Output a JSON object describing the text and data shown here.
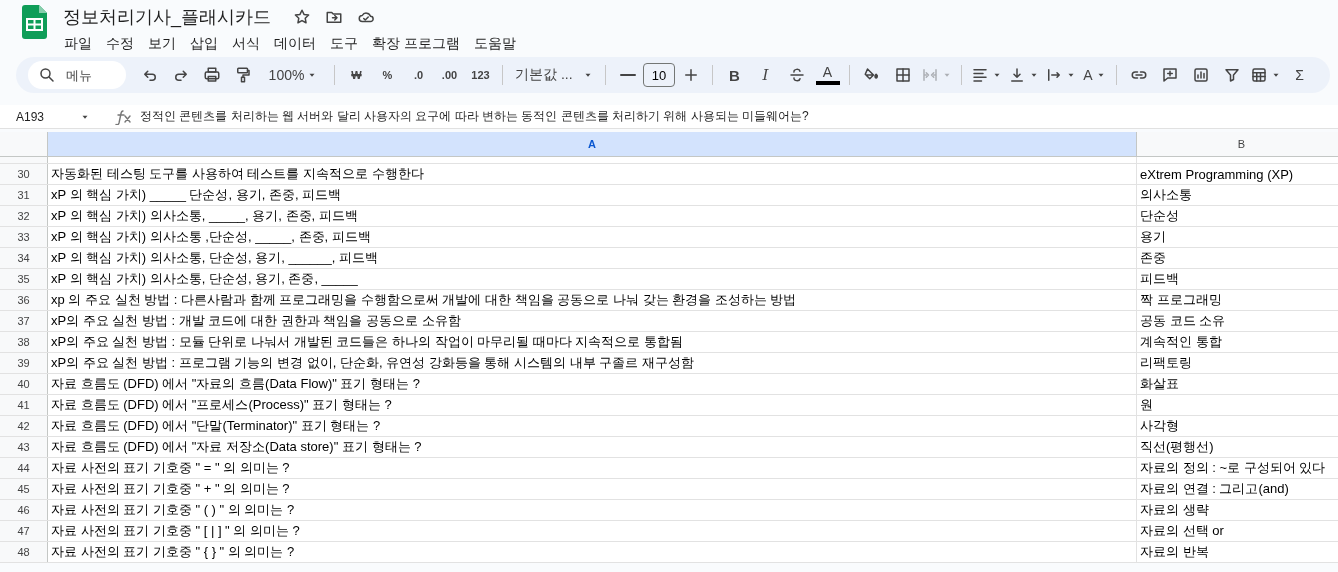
{
  "app": {
    "title": "정보처리기사_플래시카드",
    "starred": false
  },
  "menu": [
    "파일",
    "수정",
    "보기",
    "삽입",
    "서식",
    "데이터",
    "도구",
    "확장 프로그램",
    "도움말"
  ],
  "toolbar": {
    "search_placeholder": "메뉴",
    "zoom": "100%",
    "currency": "₩",
    "percent": "%",
    "decrease_decimals": ".0",
    "increase_decimals": ".00",
    "number_format": "123",
    "font": "기본값 ...",
    "font_size": "10",
    "bold": "B",
    "italic": "I",
    "text_color": "A",
    "merge_disabled": true,
    "text_rotation": "A",
    "sum": "Σ"
  },
  "formula_bar": {
    "cell": "A193",
    "formula": "정적인 콘텐츠를 처리하는 웹 서버와 달리 사용자의 요구에 따라 변하는 동적인 콘텐츠를 처리하기 위해 사용되는 미들웨어는?"
  },
  "sheet": {
    "columns": [
      {
        "label": "A",
        "selected": true
      },
      {
        "label": "B",
        "selected": false
      }
    ],
    "rows": [
      {
        "number": "30",
        "cells": [
          "자동화된 테스팅 도구를 사용하여 테스트를 지속적으로 수행한다",
          "eXtrem Programming (XP)"
        ]
      },
      {
        "number": "31",
        "cells": [
          "xP 의 핵심 가치) _____ 단순성, 용기, 존중, 피드백",
          "의사소통"
        ]
      },
      {
        "number": "32",
        "cells": [
          "xP 의 핵심 가치) 의사소통, _____, 용기, 존중, 피드백",
          "단순성"
        ]
      },
      {
        "number": "33",
        "cells": [
          "xP 의 핵심 가치)  의사소통 ,단순성, _____, 존중, 피드백",
          "용기"
        ]
      },
      {
        "number": "34",
        "cells": [
          "xP 의 핵심 가치) 의사소통, 단순성, 용기, ______, 피드백",
          "존중"
        ]
      },
      {
        "number": "35",
        "cells": [
          "xP 의 핵심 가치) 의사소통, 단순성, 용기, 존중, _____",
          "피드백"
        ]
      },
      {
        "number": "36",
        "cells": [
          "xp 의 주요 실천 방법 : 다른사람과 함께 프로그래밍을 수행함으로써 개발에 대한 책임을 공동으로 나눠 갖는 환경을 조성하는 방법",
          "짝 프로그래밍"
        ]
      },
      {
        "number": "37",
        "cells": [
          "xP의 주요 실천 방법 : 개발 코드에 대한 권한과 책임을 공동으로 소유함",
          "공동 코드 소유"
        ]
      },
      {
        "number": "38",
        "cells": [
          "xP의 주요 실천 방법 : 모듈 단위로 나눠서 개발된 코드들은 하나의 작업이 마무리될 때마다 지속적으로 통합됨",
          "계속적인 통합"
        ]
      },
      {
        "number": "39",
        "cells": [
          "xP의 주요 실천 방법 : 프로그램 기능의 변경 없이, 단순화, 유연성 강화등을 통해 시스템의 내부 구졸르 재구성함",
          "리팩토링"
        ]
      },
      {
        "number": "40",
        "cells": [
          "자료 흐름도 (DFD) 에서 \"자료의 흐름(Data Flow)\" 표기 형태는 ?",
          "화살표"
        ]
      },
      {
        "number": "41",
        "cells": [
          "자료 흐름도 (DFD) 에서 \"프로세스(Process)\" 표기 형태는 ?",
          "원"
        ]
      },
      {
        "number": "42",
        "cells": [
          "자료 흐름도 (DFD) 에서 \"단말(Terminator)\" 표기 형태는 ?",
          "사각형"
        ]
      },
      {
        "number": "43",
        "cells": [
          "자료 흐름도 (DFD) 에서 \"자료 저장소(Data store)\" 표기 형태는 ?",
          "직선(평행선)"
        ]
      },
      {
        "number": "44",
        "cells": [
          "자료 사전의 표기 기호중  \" = \" 의 의미는 ?",
          "자료의 정의 : ~로 구성되어 있다"
        ]
      },
      {
        "number": "45",
        "cells": [
          "자료 사전의 표기 기호중  \" + \" 의 의미는 ?",
          "자료의 연결 : 그리고(and)"
        ]
      },
      {
        "number": "46",
        "cells": [
          "자료 사전의 표기 기호중  \" (   ) \" 의 의미는 ?",
          "자료의 생략"
        ]
      },
      {
        "number": "47",
        "cells": [
          "자료 사전의 표기 기호중  \" [ | ] \" 의 의미는 ?",
          "자료의 선택 or"
        ]
      },
      {
        "number": "48",
        "cells": [
          "자료 사전의 표기 기호중  \" {  } \" 의 의미는 ?",
          "자료의 반복"
        ]
      }
    ]
  }
}
